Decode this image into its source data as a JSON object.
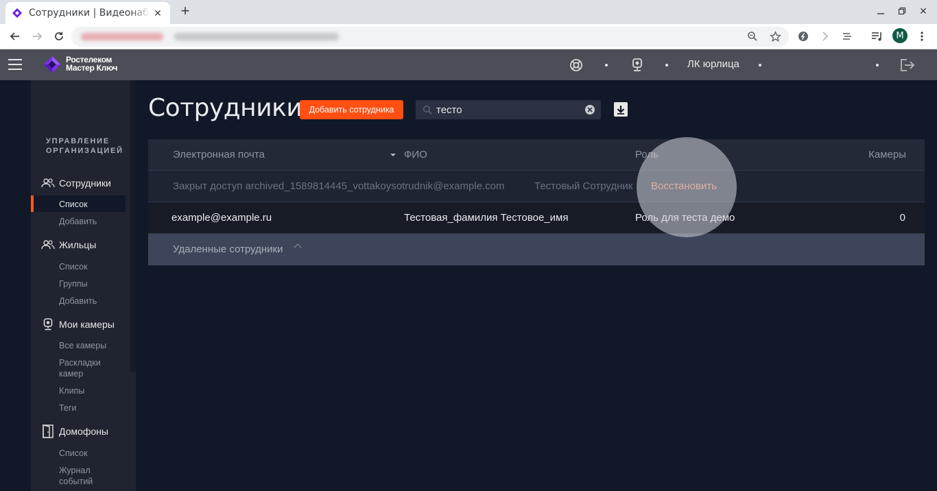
{
  "browser": {
    "tab_title": "Сотрудники | Видеонаблюдение",
    "new_tab_icon": "plus-icon",
    "profile_initial": "M",
    "colors": {
      "tabbar": "#dee1e6",
      "profile": "#0d5a46"
    }
  },
  "header": {
    "logo_line1": "Ростелеком",
    "logo_line2": "Мастер Ключ",
    "org_label": "ЛК юрлица",
    "icons": [
      "menu-icon",
      "support-icon",
      "camera-icon",
      "logout-icon"
    ],
    "colors": {
      "background": "#4b4e56",
      "logo_accent": "#7b2ff7"
    }
  },
  "sidebar": {
    "section_title": "УПРАВЛЕНИЕ ОРГАНИЗАЦИЕЙ",
    "groups": [
      {
        "label": "Сотрудники",
        "icon": "users-icon",
        "items": [
          "Список",
          "Добавить"
        ],
        "active": "Список"
      },
      {
        "label": "Жильцы",
        "icon": "residents-icon",
        "items": [
          "Список",
          "Группы",
          "Добавить"
        ]
      },
      {
        "label": "Мои камеры",
        "icon": "webcam-icon",
        "items": [
          "Все камеры",
          "Раскладки камер",
          "Клипы",
          "Теги"
        ]
      },
      {
        "label": "Домофоны",
        "icon": "door-icon",
        "items": [
          "Список",
          "Журнал событий"
        ]
      }
    ],
    "colors": {
      "active_marker": "#ff5a1f"
    }
  },
  "main": {
    "title": "Сотрудники",
    "add_button": "Добавить сотрудника",
    "search": {
      "value": "тесто",
      "placeholder": ""
    },
    "colors": {
      "primary_button": "#ff4f12",
      "restore_link": "#f08a5d"
    },
    "table": {
      "columns": [
        "Электронная почта",
        "ФИО",
        "Роль",
        "Камеры"
      ],
      "archived_row": {
        "status": "Закрыт доступ",
        "email": "archived_1589814445_vottakoysotrudnik@example.com",
        "name": "Тестовый Сотрудник",
        "action": "Восстановить"
      },
      "rows": [
        {
          "email": "example@example.ru",
          "name": "Тестовая_фамилия Тестовое_имя",
          "role": "Роль для теста демо",
          "cameras": "0"
        }
      ],
      "deleted_toggle": "Удаленные сотрудники"
    }
  }
}
